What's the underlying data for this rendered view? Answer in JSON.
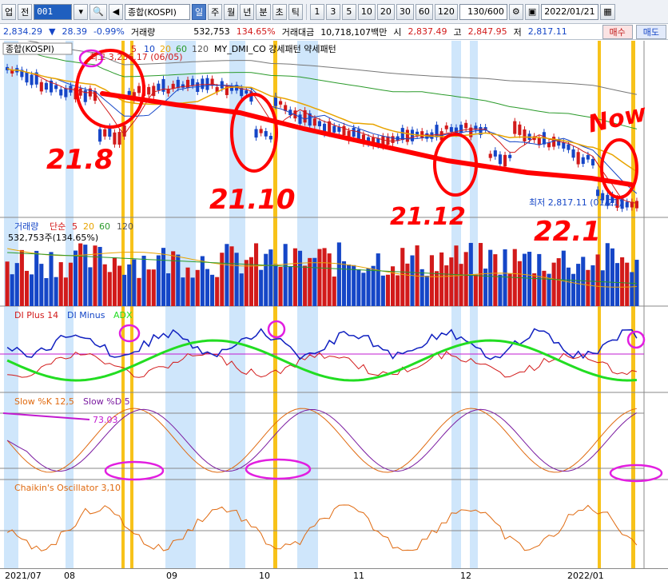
{
  "toolbar": {
    "stock_type": "업",
    "prev_label": "전",
    "code": "001",
    "name": "종합(KOSPI)",
    "periods": [
      "일",
      "주",
      "월",
      "년",
      "분",
      "초",
      "틱"
    ],
    "active_period": "일",
    "intervals": [
      "1",
      "3",
      "5",
      "10",
      "20",
      "30",
      "60",
      "120"
    ],
    "count": "130/600",
    "date": "2022/01/21"
  },
  "quote": {
    "price": "2,834.29",
    "change": "28.39",
    "change_pct": "-0.99%",
    "volume_label": "거래량",
    "volume": "532,753",
    "volume_pct": "134.65%",
    "amount_label": "거래대금",
    "amount": "10,718,107백만",
    "open_label": "시",
    "open": "2,837.49",
    "high_label": "고",
    "high": "2,847.95",
    "low_label": "저",
    "low": "2,817.11",
    "buy": "매수",
    "sell": "매도"
  },
  "panels": {
    "price": {
      "title": "종합(KOSPI)",
      "ma": [
        "5",
        "10",
        "20",
        "60",
        "120"
      ],
      "indicators": "MY_DMI_CO 강세패턴 약세패턴",
      "high_note": "최고 3,236.17 (06/05)",
      "low_note": "최저 2,817.11 (01/21)"
    },
    "volume": {
      "title": "거래량",
      "type": "단순",
      "ma": [
        "5",
        "20",
        "60",
        "120"
      ],
      "value": "532,753주(134.65%)"
    },
    "dmi": {
      "plus": "DI Plus 14",
      "minus": "DI Minus",
      "adx": "ADX"
    },
    "stoch": {
      "k": "Slow %K 12,5",
      "d": "Slow %D 5",
      "value": "73.03"
    },
    "chaikin": {
      "title": "Chaikin's Oscillator 3,10"
    }
  },
  "annotations": [
    "21.8",
    "21.10",
    "21.12",
    "22.1",
    "Now"
  ],
  "xaxis": [
    "2021/07",
    "08",
    "09",
    "10",
    "11",
    "12",
    "2022/01"
  ],
  "colors": {
    "up": "#d21a1a",
    "down": "#1546c7",
    "highlight_blue": "#cfe6fb",
    "highlight_yellow": "#f7c21a",
    "markup_red": "#ff0000",
    "markup_magenta": "#e21ee0",
    "adx_green": "#22dd22"
  }
}
